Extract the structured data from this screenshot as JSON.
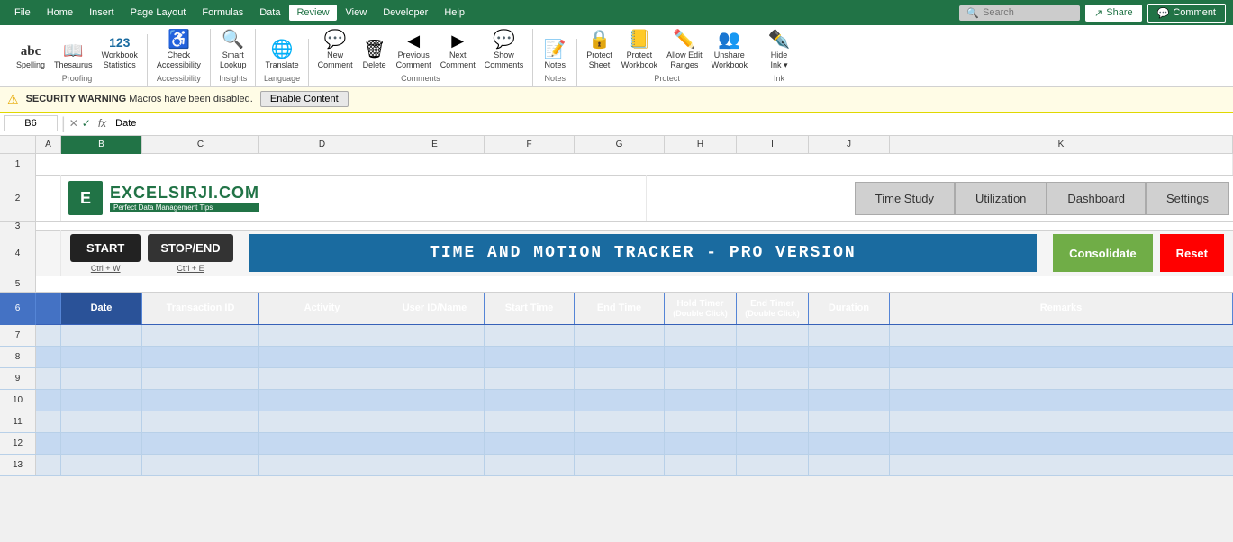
{
  "menubar": {
    "items": [
      "File",
      "Home",
      "Insert",
      "Page Layout",
      "Formulas",
      "Data",
      "Review",
      "View",
      "Developer",
      "Help"
    ],
    "active": "Review",
    "search_placeholder": "Search",
    "share_label": "Share",
    "comment_label": "Comment"
  },
  "ribbon": {
    "groups": [
      {
        "label": "Proofing",
        "items": [
          {
            "id": "spelling",
            "icon": "abc",
            "label": "Spelling"
          },
          {
            "id": "thesaurus",
            "icon": "📖",
            "label": "Thesaurus"
          },
          {
            "id": "workbook-stats",
            "icon": "123",
            "label": "Workbook\nStatistics"
          }
        ]
      },
      {
        "label": "Accessibility",
        "items": [
          {
            "id": "check-accessibility",
            "icon": "✓",
            "label": "Check\nAccessibility"
          }
        ]
      },
      {
        "label": "Insights",
        "items": [
          {
            "id": "smart-lookup",
            "icon": "🔍",
            "label": "Smart\nLookup"
          }
        ]
      },
      {
        "label": "Language",
        "items": [
          {
            "id": "translate",
            "icon": "🌐",
            "label": "Translate"
          }
        ]
      },
      {
        "label": "Comments",
        "items": [
          {
            "id": "new-comment",
            "icon": "💬",
            "label": "New\nComment"
          },
          {
            "id": "delete-comment",
            "icon": "🗑",
            "label": "Delete"
          },
          {
            "id": "previous-comment",
            "icon": "◀",
            "label": "Previous\nComment"
          },
          {
            "id": "next-comment",
            "icon": "▶",
            "label": "Next\nComment"
          },
          {
            "id": "show-comments",
            "icon": "💬",
            "label": "Show\nComments"
          }
        ]
      },
      {
        "label": "Notes",
        "items": [
          {
            "id": "notes",
            "icon": "📝",
            "label": "Notes"
          }
        ]
      },
      {
        "label": "Protect",
        "items": [
          {
            "id": "protect-sheet",
            "icon": "🔒",
            "label": "Protect\nSheet"
          },
          {
            "id": "protect-workbook",
            "icon": "📒",
            "label": "Protect\nWorkbook"
          },
          {
            "id": "allow-edit-ranges",
            "icon": "✏",
            "label": "Allow Edit\nRanges"
          },
          {
            "id": "unshare-workbook",
            "icon": "👥",
            "label": "Unshare\nWorkbook"
          }
        ]
      },
      {
        "label": "Ink",
        "items": [
          {
            "id": "hide-ink",
            "icon": "✒",
            "label": "Hide\nInk"
          }
        ]
      }
    ]
  },
  "formula_bar": {
    "cell_ref": "B6",
    "formula": "Date"
  },
  "security_warning": {
    "icon": "⚠",
    "bold_text": "SECURITY WARNING",
    "message": "Macros have been disabled.",
    "button_label": "Enable Content"
  },
  "spreadsheet": {
    "col_headers": [
      "A",
      "B",
      "C",
      "D",
      "E",
      "F",
      "G",
      "H",
      "I",
      "J",
      "K"
    ],
    "selected_col": "B"
  },
  "logo": {
    "name": "EXCELSIRJI.COM",
    "tagline": "Perfect Data Management Tips"
  },
  "nav_buttons": [
    {
      "id": "time-study",
      "label": "Time Study",
      "active": false
    },
    {
      "id": "utilization",
      "label": "Utilization",
      "active": false
    },
    {
      "id": "dashboard",
      "label": "Dashboard",
      "active": false
    },
    {
      "id": "settings",
      "label": "Settings",
      "active": false
    }
  ],
  "tracker": {
    "start_label": "START",
    "start_shortcut": "Ctrl + W",
    "stopend_label": "STOP/END",
    "stopend_shortcut": "Ctrl + E",
    "title": "TIME AND MOTION TRACKER - PRO VERSION",
    "consolidate_label": "Consolidate",
    "reset_label": "Reset"
  },
  "table": {
    "headers": [
      {
        "id": "date",
        "label": "Date"
      },
      {
        "id": "transaction-id",
        "label": "Transaction ID"
      },
      {
        "id": "activity",
        "label": "Activity"
      },
      {
        "id": "user-id",
        "label": "User ID/Name"
      },
      {
        "id": "start-time",
        "label": "Start Time"
      },
      {
        "id": "end-time",
        "label": "End Time"
      },
      {
        "id": "hold-timer",
        "label": "Hold Timer\n(Double Click)"
      },
      {
        "id": "end-timer",
        "label": "End Timer\n(Double Click)"
      },
      {
        "id": "duration",
        "label": "Duration"
      },
      {
        "id": "remarks",
        "label": "Remarks"
      }
    ],
    "rows": [
      6,
      7,
      8,
      9,
      10,
      11,
      12,
      13
    ]
  }
}
